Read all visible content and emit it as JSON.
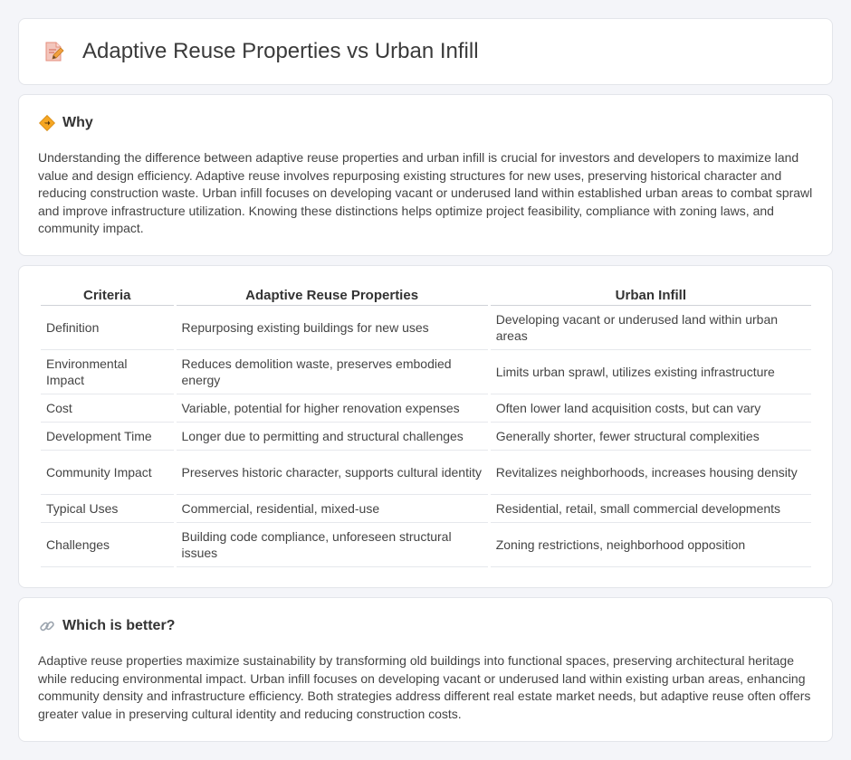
{
  "header": {
    "title": "Adaptive Reuse Properties vs Urban Infill",
    "icon": "document-edit-icon"
  },
  "why": {
    "icon": "diamond-sign-icon",
    "title": "Why",
    "text": "Understanding the difference between adaptive reuse properties and urban infill is crucial for investors and developers to maximize land value and design efficiency. Adaptive reuse involves repurposing existing structures for new uses, preserving historical character and reducing construction waste. Urban infill focuses on developing vacant or underused land within established urban areas to combat sprawl and improve infrastructure utilization. Knowing these distinctions helps optimize project feasibility, compliance with zoning laws, and community impact."
  },
  "comparison": {
    "headers": [
      "Criteria",
      "Adaptive Reuse Properties",
      "Urban Infill"
    ],
    "rows": [
      {
        "criteria": "Definition",
        "adaptive": "Repurposing existing buildings for new uses",
        "infill": "Developing vacant or underused land within urban areas"
      },
      {
        "criteria": "Environmental Impact",
        "adaptive": "Reduces demolition waste, preserves embodied energy",
        "infill": "Limits urban sprawl, utilizes existing infrastructure"
      },
      {
        "criteria": "Cost",
        "adaptive": "Variable, potential for higher renovation expenses",
        "infill": "Often lower land acquisition costs, but can vary"
      },
      {
        "criteria": "Development Time",
        "adaptive": "Longer due to permitting and structural challenges",
        "infill": "Generally shorter, fewer structural complexities"
      },
      {
        "criteria": "Community Impact",
        "adaptive": "Preserves historic character, supports cultural identity",
        "infill": "Revitalizes neighborhoods, increases housing density"
      },
      {
        "criteria": "Typical Uses",
        "adaptive": "Commercial, residential, mixed-use",
        "infill": "Residential, retail, small commercial developments"
      },
      {
        "criteria": "Challenges",
        "adaptive": "Building code compliance, unforeseen structural issues",
        "infill": "Zoning restrictions, neighborhood opposition"
      }
    ]
  },
  "better": {
    "icon": "link-icon",
    "title": "Which is better?",
    "text": "Adaptive reuse properties maximize sustainability by transforming old buildings into functional spaces, preserving architectural heritage while reducing environmental impact. Urban infill focuses on developing vacant or underused land within existing urban areas, enhancing community density and infrastructure efficiency. Both strategies address different real estate market needs, but adaptive reuse often offers greater value in preserving cultural identity and reducing construction costs."
  }
}
